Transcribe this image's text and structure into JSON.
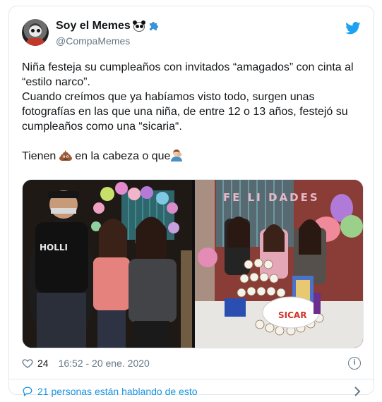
{
  "user": {
    "display_name": "Soy el Memes",
    "handle": "@CompaMemes",
    "verified_badge_icon": "puzzle-icon",
    "name_emoji": "panda-icon"
  },
  "tweet": {
    "line1": "Niña festeja su cumpleaños con invitados “amagados” con cinta al “estilo narco”.",
    "line2": "Cuando creímos que ya habíamos visto todo, surgen unas fotografías en las que una niña, de entre 12 o 13 años, festejó su cumpleaños como una “sicaria“.",
    "line3_before": "Tienen ",
    "line3_middle": " en la cabeza o que",
    "emoji_1": "poop-icon",
    "emoji_2": "person-facepalming-icon"
  },
  "meta": {
    "likes": "24",
    "timestamp": "16:52 - 20 ene. 2020"
  },
  "footer": {
    "conversation": "21 personas están hablando de esto"
  },
  "colors": {
    "brand_blue": "#1da1f2",
    "link_blue": "#1b95e0",
    "text": "#14171a",
    "secondary": "#657786",
    "border": "#e1e8ed"
  }
}
